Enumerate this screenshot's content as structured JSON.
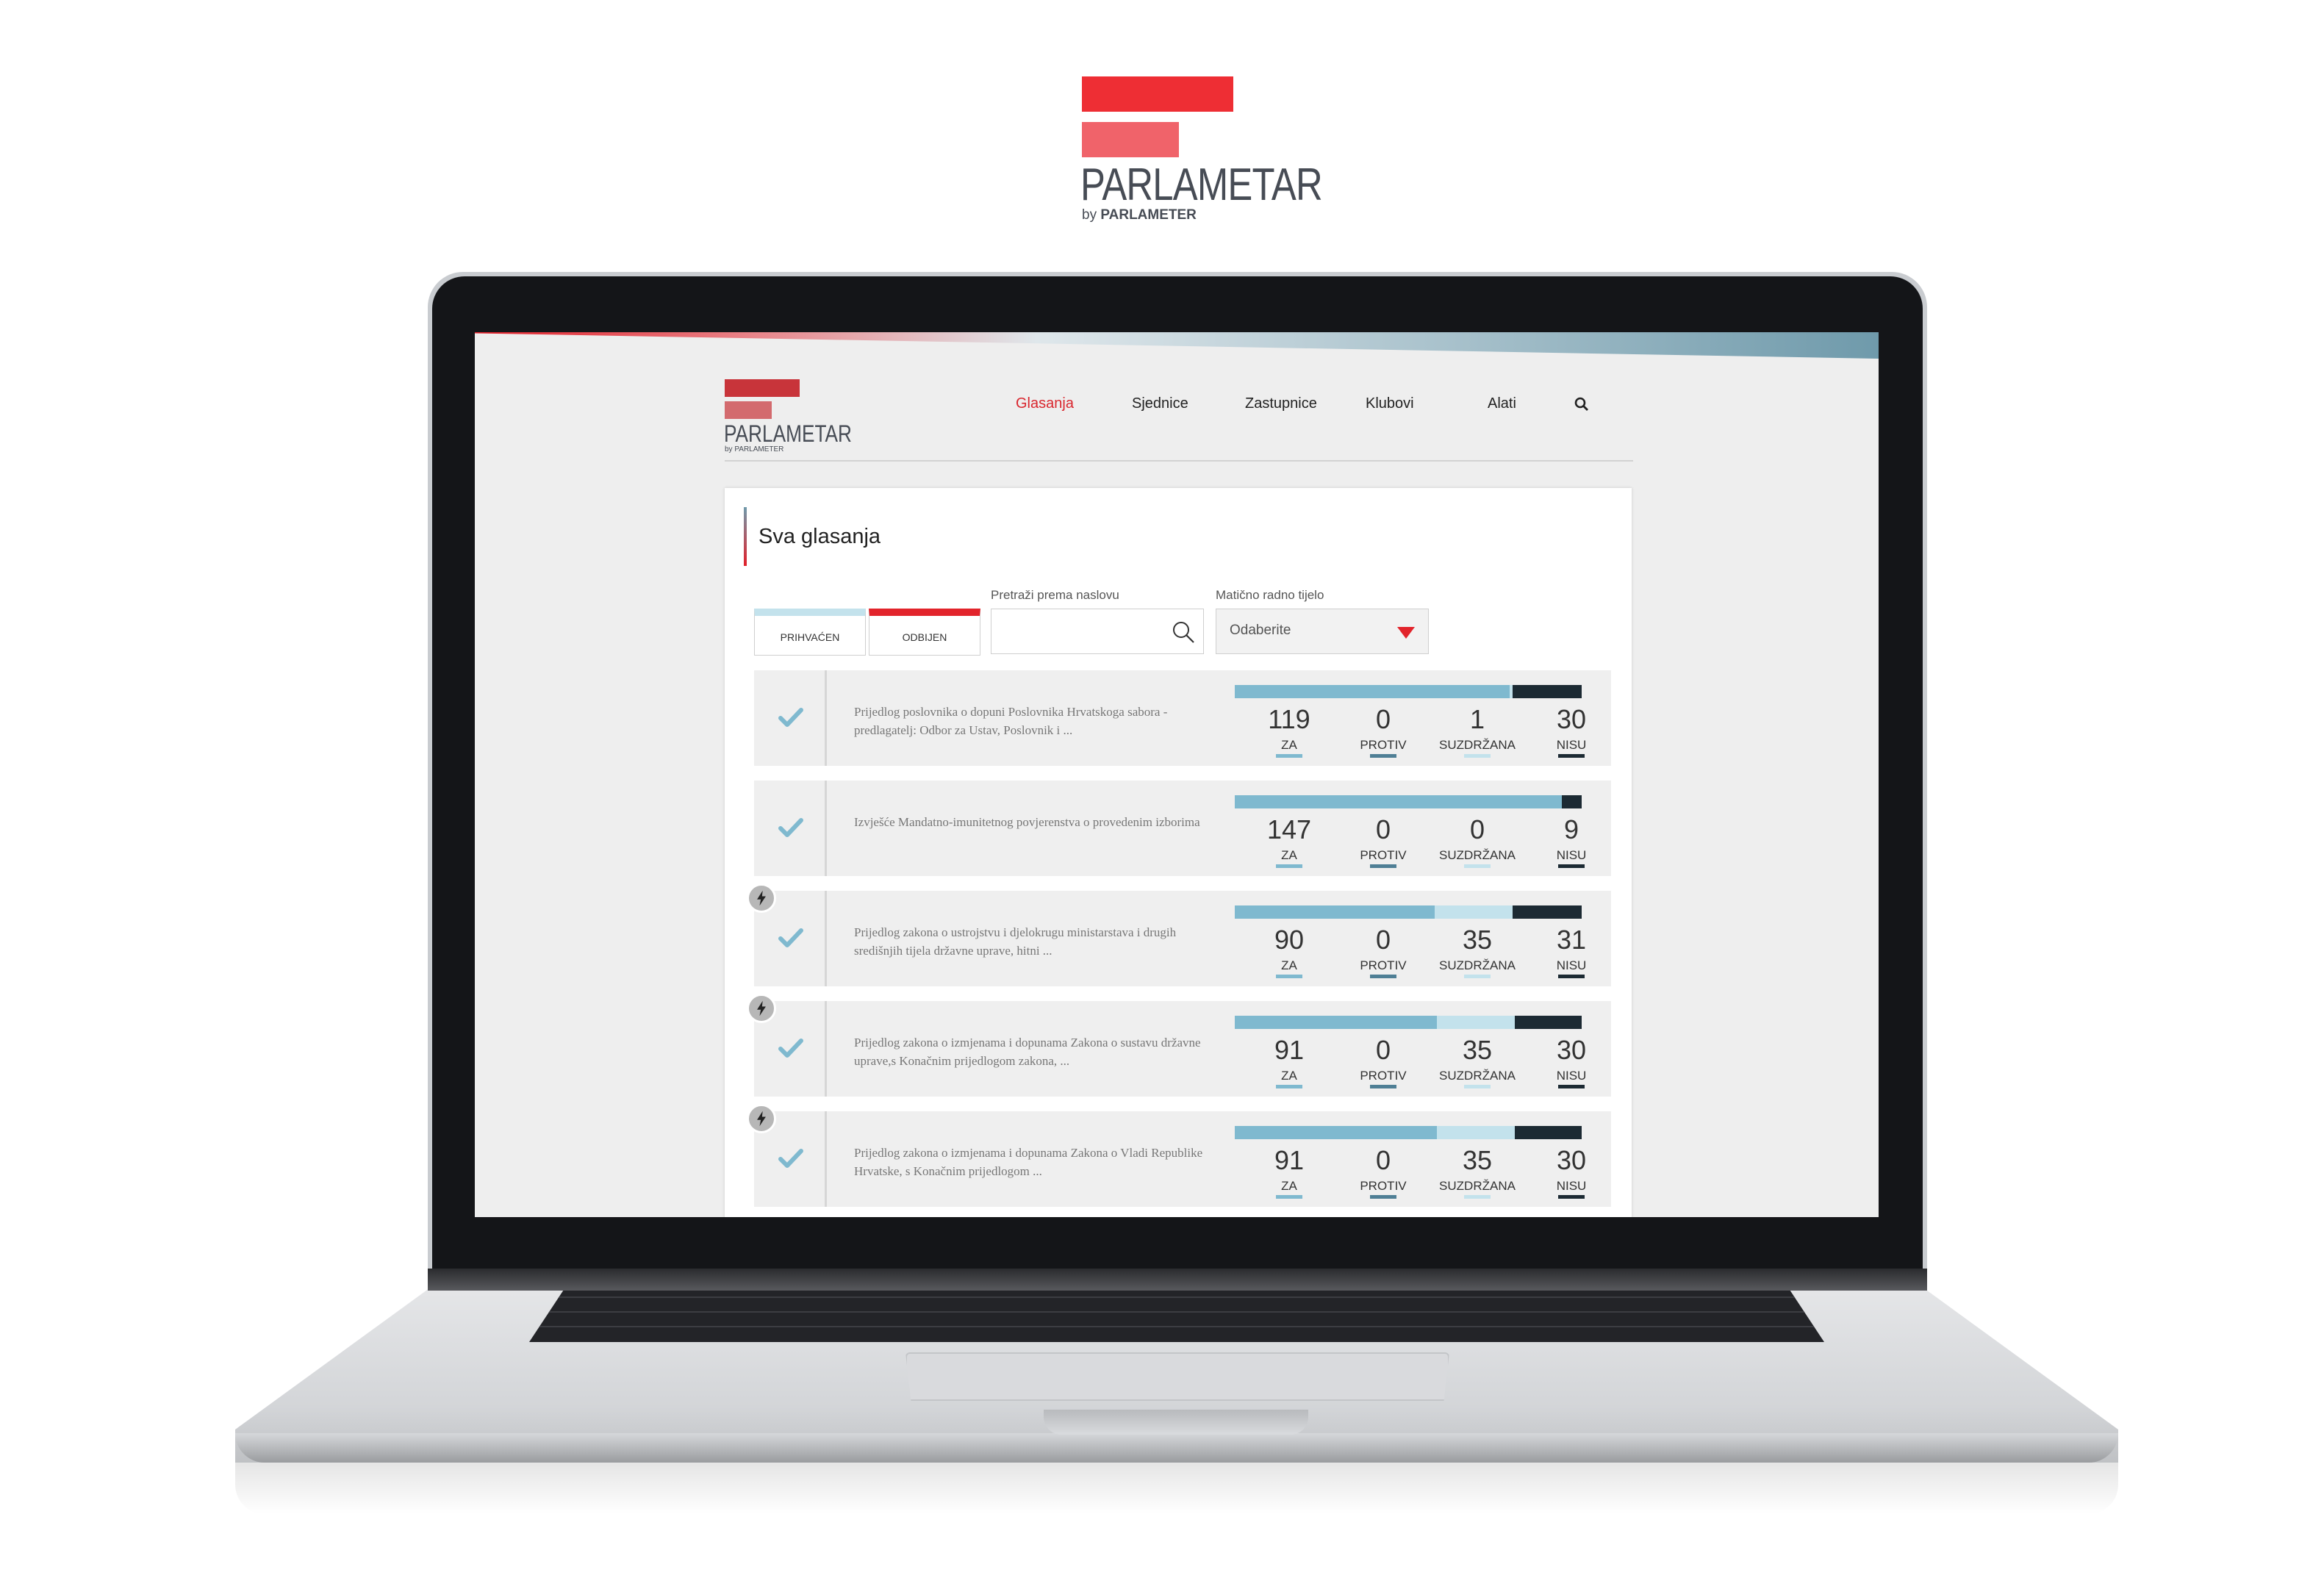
{
  "brand": {
    "name": "PARLAMETAR",
    "sub_prefix": "by",
    "sub_name": "PARLAMETER"
  },
  "nav": {
    "items": [
      {
        "label": "Glasanja",
        "active": true
      },
      {
        "label": "Sjednice",
        "active": false
      },
      {
        "label": "Zastupnice",
        "active": false
      },
      {
        "label": "Klubovi",
        "active": false
      },
      {
        "label": "Alati",
        "active": false
      }
    ]
  },
  "page": {
    "title": "Sva glasanja"
  },
  "filters": {
    "accepted_label": "PRIHVAĆEN",
    "rejected_label": "ODBIJEN",
    "search_label": "Pretraži prema naslovu",
    "search_value": "",
    "committee_label": "Matično radno tijelo",
    "committee_value": "Odaberite"
  },
  "labels": {
    "za": "ZA",
    "protiv": "PROTIV",
    "suzdrzana": "SUZDRŽANA",
    "nisu": "NISU"
  },
  "colors": {
    "za": "#7fb9cf",
    "protiv": "#4f7f95",
    "suzdrzana": "#c3e2ec",
    "nisu": "#1c2a33",
    "accent": "#e2242b"
  },
  "votes": [
    {
      "title": "Prijedlog poslovnika o dopuni Poslovnika Hrvatskoga sabora - predlagatelj: Odbor za Ustav, Poslovnik i ...",
      "za": "119",
      "protiv": "0",
      "suzdrzana": "1",
      "nisu": "30",
      "urgent": false
    },
    {
      "title": "Izvješće Mandatno-imunitetnog povjerenstva o provedenim izborima",
      "za": "147",
      "protiv": "0",
      "suzdrzana": "0",
      "nisu": "9",
      "urgent": false
    },
    {
      "title": "Prijedlog zakona o ustrojstvu i djelokrugu ministarstava i drugih središnjih tijela državne uprave, hitni ...",
      "za": "90",
      "protiv": "0",
      "suzdrzana": "35",
      "nisu": "31",
      "urgent": true
    },
    {
      "title": "Prijedlog zakona o izmjenama i dopunama Zakona o sustavu državne uprave,s Konačnim prijedlogom zakona, ...",
      "za": "91",
      "protiv": "0",
      "suzdrzana": "35",
      "nisu": "30",
      "urgent": true
    },
    {
      "title": "Prijedlog zakona o izmjenama i dopunama Zakona o Vladi Republike Hrvatske, s Konačnim prijedlogom ...",
      "za": "91",
      "protiv": "0",
      "suzdrzana": "35",
      "nisu": "30",
      "urgent": true
    }
  ]
}
